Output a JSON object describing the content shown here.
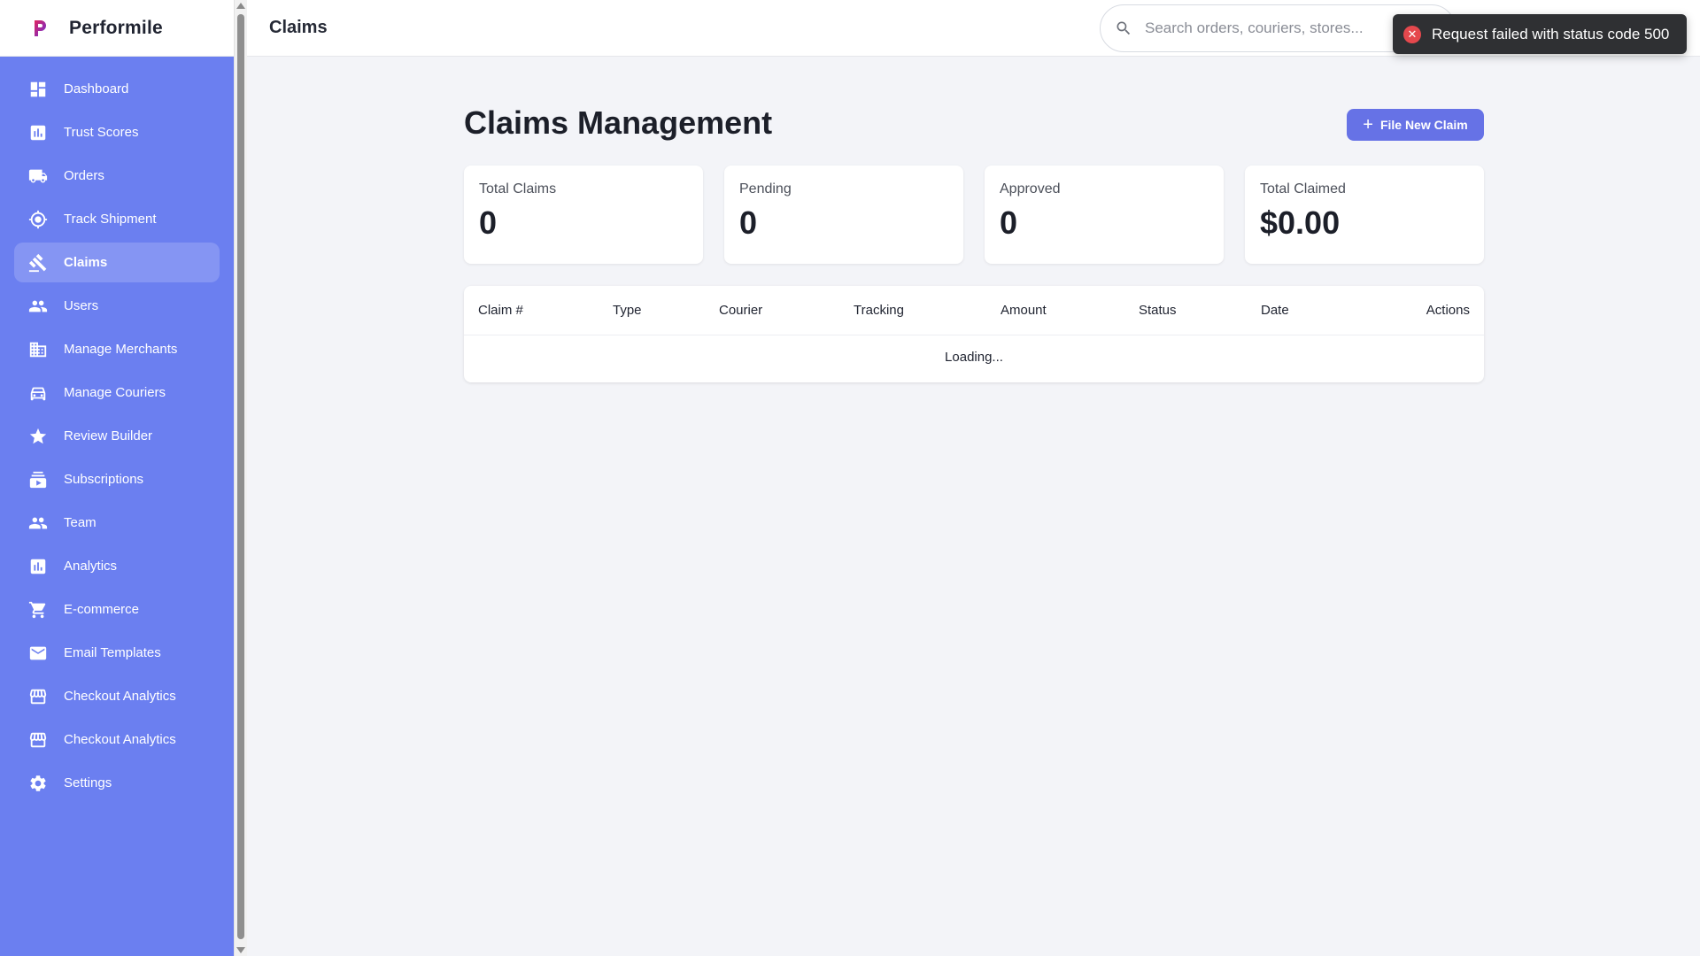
{
  "brand": {
    "name": "Performile"
  },
  "header": {
    "title": "Claims"
  },
  "search": {
    "placeholder": "Search orders, couriers, stores..."
  },
  "toast": {
    "message": "Request failed with status code 500"
  },
  "sidebar": {
    "items": [
      {
        "label": "Dashboard",
        "icon": "dashboard-icon"
      },
      {
        "label": "Trust Scores",
        "icon": "bar-chart-icon"
      },
      {
        "label": "Orders",
        "icon": "truck-icon"
      },
      {
        "label": "Track Shipment",
        "icon": "location-target-icon"
      },
      {
        "label": "Claims",
        "icon": "gavel-icon",
        "active": true
      },
      {
        "label": "Users",
        "icon": "people-icon"
      },
      {
        "label": "Manage Merchants",
        "icon": "building-icon"
      },
      {
        "label": "Manage Couriers",
        "icon": "car-icon"
      },
      {
        "label": "Review Builder",
        "icon": "star-icon"
      },
      {
        "label": "Subscriptions",
        "icon": "subscriptions-icon"
      },
      {
        "label": "Team",
        "icon": "people-icon"
      },
      {
        "label": "Analytics",
        "icon": "bar-chart-icon"
      },
      {
        "label": "E-commerce",
        "icon": "cart-icon"
      },
      {
        "label": "Email Templates",
        "icon": "mail-icon"
      },
      {
        "label": "Checkout Analytics",
        "icon": "store-icon"
      },
      {
        "label": "Checkout Analytics",
        "icon": "store-icon"
      },
      {
        "label": "Settings",
        "icon": "gear-icon"
      }
    ]
  },
  "main": {
    "title": "Claims Management",
    "new_claim_label": "File New Claim",
    "stats": [
      {
        "label": "Total Claims",
        "value": "0"
      },
      {
        "label": "Pending",
        "value": "0"
      },
      {
        "label": "Approved",
        "value": "0"
      },
      {
        "label": "Total Claimed",
        "value": "$0.00"
      }
    ],
    "table": {
      "columns": [
        "Claim #",
        "Type",
        "Courier",
        "Tracking",
        "Amount",
        "Status",
        "Date",
        "Actions"
      ],
      "loading_text": "Loading..."
    }
  },
  "colors": {
    "sidebar_bg": "#6b7ff0",
    "accent": "#6672e6",
    "error": "#e5484d"
  }
}
